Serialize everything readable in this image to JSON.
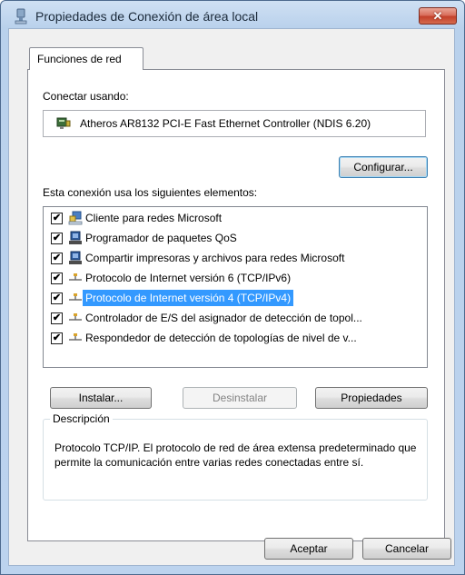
{
  "window": {
    "title": "Propiedades de Conexión de área local",
    "close_glyph": "✕",
    "icon": "network-connection-icon"
  },
  "tabs": [
    {
      "label": "Funciones de red",
      "selected": true
    }
  ],
  "connect_using": {
    "label": "Conectar usando:",
    "adapter": "Atheros AR8132 PCI-E Fast Ethernet Controller (NDIS 6.20)",
    "adapter_icon": "network-adapter-icon",
    "configure_button": "Configurar..."
  },
  "items_section": {
    "label": "Esta conexión usa los siguientes elementos:",
    "items": [
      {
        "label": "Cliente para redes Microsoft",
        "checked": true,
        "icon": "network-client-icon",
        "selected": false
      },
      {
        "label": "Programador de paquetes QoS",
        "checked": true,
        "icon": "network-service-icon",
        "selected": false
      },
      {
        "label": "Compartir impresoras y archivos para redes Microsoft",
        "checked": true,
        "icon": "network-service-icon",
        "selected": false
      },
      {
        "label": "Protocolo de Internet versión 6 (TCP/IPv6)",
        "checked": true,
        "icon": "protocol-icon",
        "selected": false
      },
      {
        "label": "Protocolo de Internet versión 4 (TCP/IPv4)",
        "checked": true,
        "icon": "protocol-icon",
        "selected": true
      },
      {
        "label": "Controlador de E/S del asignador de detección de topol...",
        "checked": true,
        "icon": "protocol-icon",
        "selected": false
      },
      {
        "label": "Respondedor de detección de topologías de nivel de v...",
        "checked": true,
        "icon": "protocol-icon",
        "selected": false
      }
    ],
    "check_glyph": "✔"
  },
  "actions": {
    "install": "Instalar...",
    "uninstall": "Desinstalar",
    "properties": "Propiedades"
  },
  "description": {
    "title": "Descripción",
    "text": "Protocolo TCP/IP. El protocolo de red de área extensa predeterminado que permite la comunicación entre varias redes conectadas entre sí."
  },
  "footer": {
    "ok": "Aceptar",
    "cancel": "Cancelar"
  }
}
